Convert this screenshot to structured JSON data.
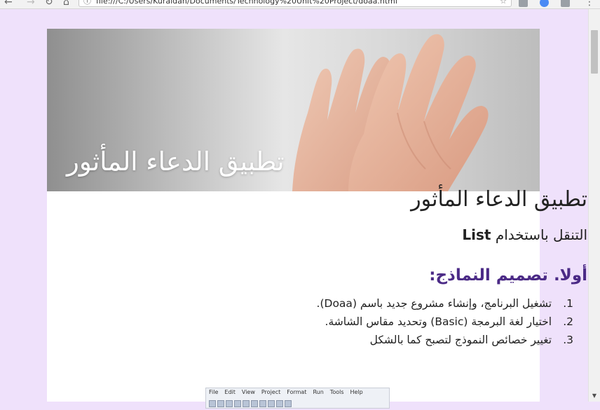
{
  "browser": {
    "url": "file:///C:/Users/Kuraidah/Documents/Technology%20Unit%20Project/doaa.html"
  },
  "hero": {
    "title": "تطبيق الدعاء المأثور"
  },
  "main": {
    "title": "تطبيق الدعاء المأثور",
    "subtitle_ar": "التنقل باستخدام ",
    "subtitle_en": "List",
    "section_heading": "أولا. تصميم النماذج:",
    "steps": [
      {
        "num": "1.",
        "text": "تشغيل البرنامج، وإنشاء مشروع جديد باسم (Doaa)."
      },
      {
        "num": "2.",
        "text": "اختيار لغة البرمجة (Basic) وتحديد مقاس الشاشة."
      },
      {
        "num": "3.",
        "text": "تغيير خصائص النموذج لتصبح كما بالشكل"
      }
    ]
  },
  "ide_screenshot": {
    "menu": [
      "File",
      "Edit",
      "View",
      "Project",
      "Format",
      "Run",
      "Tools",
      "Help"
    ]
  },
  "colors": {
    "page_background": "#efe1fb",
    "section_heading": "#4b2a86"
  }
}
